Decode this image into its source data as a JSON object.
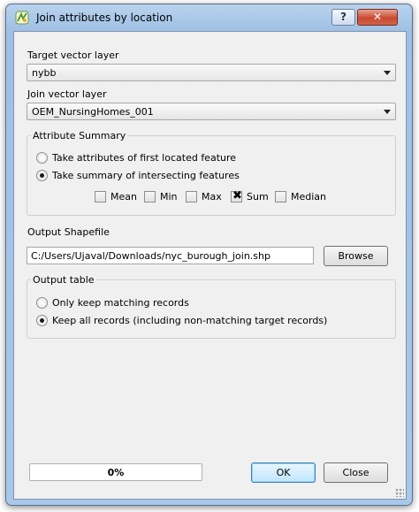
{
  "window": {
    "title": "Join attributes by location",
    "help_label": "?",
    "close_label": "✕"
  },
  "target_layer": {
    "label": "Target vector layer",
    "value": "nybb"
  },
  "join_layer": {
    "label": "Join vector layer",
    "value": "OEM_NursingHomes_001"
  },
  "attribute_summary": {
    "title": "Attribute Summary",
    "options": [
      {
        "label": "Take attributes of first located feature",
        "checked": false
      },
      {
        "label": "Take summary of intersecting features",
        "checked": true
      }
    ],
    "stats": [
      {
        "label": "Mean",
        "checked": false
      },
      {
        "label": "Min",
        "checked": false
      },
      {
        "label": "Max",
        "checked": false
      },
      {
        "label": "Sum",
        "checked": true
      },
      {
        "label": "Median",
        "checked": false
      }
    ]
  },
  "output": {
    "label": "Output Shapefile",
    "value": "C:/Users/Ujaval/Downloads/nyc_burough_join.shp",
    "browse_label": "Browse"
  },
  "output_table": {
    "title": "Output table",
    "options": [
      {
        "label": "Only keep matching records",
        "checked": false
      },
      {
        "label": "Keep all records (including non-matching target records)",
        "checked": true
      }
    ]
  },
  "progress": {
    "value": 0,
    "text": "0%"
  },
  "buttons": {
    "ok": "OK",
    "close": "Close"
  }
}
